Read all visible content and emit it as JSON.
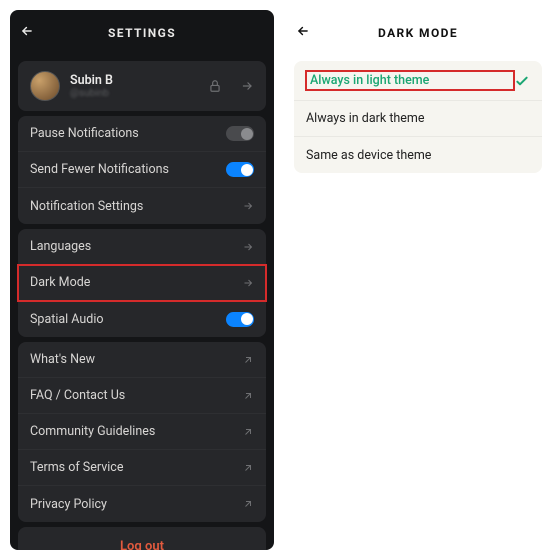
{
  "settings": {
    "title": "SETTINGS",
    "profile": {
      "name": "Subin B",
      "sub": "@subinb"
    },
    "notif": {
      "pause": "Pause Notifications",
      "fewer": "Send Fewer Notifications",
      "settings": "Notification Settings"
    },
    "prefs": {
      "languages": "Languages",
      "dark_mode": "Dark Mode",
      "spatial": "Spatial Audio"
    },
    "links": {
      "whats_new": "What's New",
      "faq": "FAQ / Contact Us",
      "guidelines": "Community Guidelines",
      "tos": "Terms of Service",
      "privacy": "Privacy Policy"
    },
    "logout": "Log out",
    "toggles": {
      "pause": false,
      "fewer": true,
      "spatial": true
    }
  },
  "darkmode": {
    "title": "DARK MODE",
    "options": {
      "light": "Always in light theme",
      "dark": "Always in dark theme",
      "device": "Same as device theme"
    },
    "selected": "light"
  }
}
